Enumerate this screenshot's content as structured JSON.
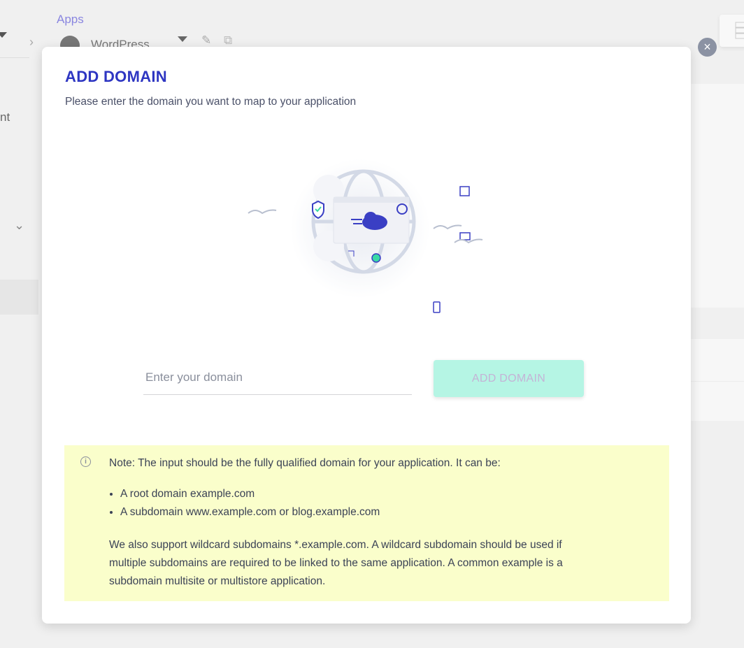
{
  "background": {
    "breadcrumb": "Apps",
    "app_name": "WordPress",
    "left_partial_text": "nt"
  },
  "modal": {
    "title": "ADD DOMAIN",
    "subtitle": "Please enter the domain you want to map to your application",
    "input": {
      "value": "",
      "placeholder": "Enter your domain"
    },
    "add_button": "ADD DOMAIN",
    "close_icon": "×",
    "note": {
      "intro": "Note: The input should be the fully qualified domain for your application. It can be:",
      "items": [
        "A root domain example.com",
        "A subdomain www.example.com or blog.example.com"
      ],
      "paragraph": "We also support wildcard subdomains *.example.com. A wildcard subdomain should be used if multiple subdomains are required to be linked to the same application. A common example is a subdomain multisite or multistore application."
    }
  },
  "colors": {
    "accent": "#2e36c2",
    "button_bg": "#b5f5e4",
    "note_bg": "#fafecb"
  }
}
